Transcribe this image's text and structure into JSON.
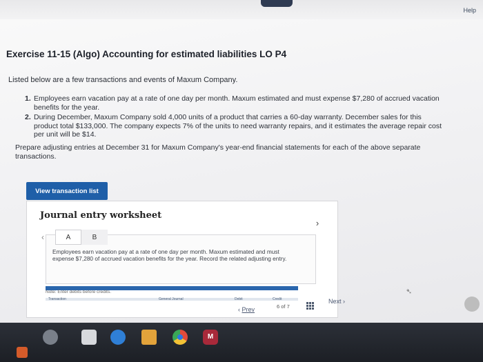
{
  "header": {
    "help_label": "Help"
  },
  "exercise": {
    "title": "Exercise 11-15 (Algo) Accounting for estimated liabilities LO P4",
    "intro": "Listed below are a few transactions and events of Maxum Company.",
    "items": [
      {
        "number": "1.",
        "text": "Employees earn vacation pay at a rate of one day per month. Maxum estimated and must expense $7,280 of accrued vacation benefits for the year."
      },
      {
        "number": "2.",
        "text": "During December, Maxum Company sold 4,000 units of a product that carries a 60-day warranty. December sales for this product total $133,000. The company expects 7% of the units to need warranty repairs, and it estimates the average repair cost per unit will be $14."
      }
    ],
    "instructions": "Prepare adjusting entries at December 31 for Maxum Company's year-end financial statements for each of the above separate transactions."
  },
  "actions": {
    "view_transaction_list": "View transaction list"
  },
  "worksheet": {
    "title": "Journal entry worksheet",
    "tabs": [
      "A",
      "B"
    ],
    "instruction_text": "Employees earn vacation pay at a rate of one day per month. Maxum estimated and must expense $7,280 of accrued vacation benefits for the year. Record the related adjusting entry.",
    "note": "Note: Enter debits before credits.",
    "columns": [
      "Transaction",
      "General Journal",
      "Debit",
      "Credit"
    ]
  },
  "pagination": {
    "prev_label": "Prev",
    "page_text": "6 of 7",
    "next_label": "Next"
  },
  "colors": {
    "primary_button": "#1f5fa8",
    "table_header": "#2a66ad"
  }
}
